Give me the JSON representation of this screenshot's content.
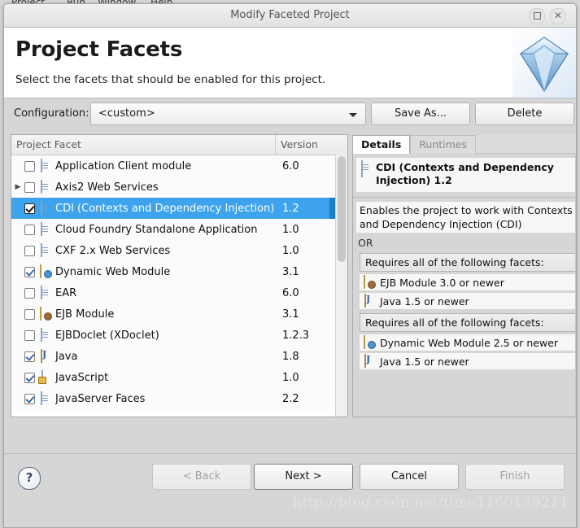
{
  "background_menubar": [
    "Project",
    "Run",
    "Window",
    "Help"
  ],
  "window": {
    "title": "Modify Faceted Project",
    "maximize_icon": "maximize-icon",
    "close_icon": "close-icon",
    "close_glyph": "✕"
  },
  "header": {
    "title": "Project Facets",
    "subtitle": "Select the facets that should be enabled for this project.",
    "icon": "diamond-gem-icon"
  },
  "configuration": {
    "label": "Configuration:",
    "value": "<custom>",
    "options": [
      "<custom>"
    ],
    "save_as_label": "Save As...",
    "delete_label": "Delete"
  },
  "table": {
    "columns": [
      "Project Facet",
      "Version"
    ],
    "rows": [
      {
        "name": "Application Client module",
        "version": "6.0",
        "checked": false,
        "icon": "document-icon",
        "expandable": false,
        "dropdown": true
      },
      {
        "name": "Axis2 Web Services",
        "version": "",
        "checked": false,
        "icon": "document-icon",
        "expandable": true,
        "dropdown": false
      },
      {
        "name": "CDI (Contexts and Dependency Injection)",
        "version": "1.2",
        "checked": true,
        "icon": "document-icon",
        "expandable": false,
        "dropdown": true,
        "selected": true
      },
      {
        "name": "Cloud Foundry Standalone Application",
        "version": "1.0",
        "checked": false,
        "icon": "document-icon",
        "expandable": false,
        "dropdown": false
      },
      {
        "name": "CXF 2.x Web Services",
        "version": "1.0",
        "checked": false,
        "icon": "document-icon",
        "expandable": false,
        "dropdown": false
      },
      {
        "name": "Dynamic Web Module",
        "version": "3.1",
        "checked": true,
        "icon": "web-module-icon",
        "expandable": false,
        "dropdown": true
      },
      {
        "name": "EAR",
        "version": "6.0",
        "checked": false,
        "icon": "document-icon",
        "expandable": false,
        "dropdown": true
      },
      {
        "name": "EJB Module",
        "version": "3.1",
        "checked": false,
        "icon": "ejb-jar-icon",
        "expandable": false,
        "dropdown": true
      },
      {
        "name": "EJBDoclet (XDoclet)",
        "version": "1.2.3",
        "checked": false,
        "icon": "document-icon",
        "expandable": false,
        "dropdown": true
      },
      {
        "name": "Java",
        "version": "1.8",
        "checked": true,
        "icon": "java-icon",
        "expandable": false,
        "dropdown": true
      },
      {
        "name": "JavaScript",
        "version": "1.0",
        "checked": true,
        "icon": "javascript-lock-icon",
        "expandable": false,
        "dropdown": false
      },
      {
        "name": "JavaServer Faces",
        "version": "2.2",
        "checked": true,
        "icon": "document-icon",
        "expandable": false,
        "dropdown": true
      }
    ]
  },
  "details_panel": {
    "tabs": [
      {
        "label": "Details",
        "active": true
      },
      {
        "label": "Runtimes",
        "active": false
      }
    ],
    "facet_title": "CDI (Contexts and Dependency Injection) 1.2",
    "facet_icon": "document-icon",
    "description": "Enables the project to work with Contexts and Dependency Injection (CDI)",
    "or_label": "OR",
    "requirement_groups": [
      {
        "header": "Requires all of the following facets:",
        "items": [
          {
            "label": "EJB Module 3.0 or newer",
            "icon": "ejb-jar-icon"
          },
          {
            "label": "Java 1.5 or newer",
            "icon": "java-icon"
          }
        ]
      },
      {
        "header": "Requires all of the following facets:",
        "items": [
          {
            "label": "Dynamic Web Module 2.5 or newer",
            "icon": "web-module-icon"
          },
          {
            "label": "Java 1.5 or newer",
            "icon": "java-icon"
          }
        ]
      }
    ]
  },
  "footer": {
    "help_label": "?",
    "help_icon": "help-icon",
    "back_label": "< Back",
    "next_label": "Next >",
    "cancel_label": "Cancel",
    "finish_label": "Finish",
    "back_disabled": true,
    "finish_disabled": true
  },
  "watermark": "http://blog.csdn.net/timo1160139211",
  "colors": {
    "selection_blue": "#3da3ec",
    "window_bg": "#d6d6d6",
    "panel_white": "#ffffff"
  }
}
